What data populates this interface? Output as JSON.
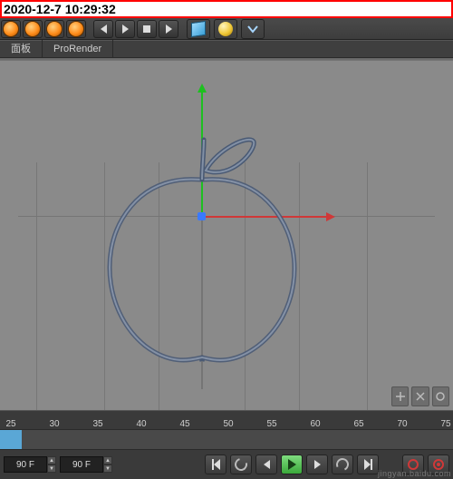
{
  "timestamp": "2020-12-7 10:29:32",
  "tabs": {
    "panel": "面板",
    "prorender": "ProRender"
  },
  "colors": {
    "axis_x": "#d03838",
    "axis_y": "#1ec020",
    "grid": "#777777",
    "viewport_bg": "#8a8a8a"
  },
  "timeline": {
    "ruler_marks": [
      "25",
      "30",
      "35",
      "40",
      "45",
      "50",
      "55",
      "60",
      "65",
      "70",
      "75"
    ],
    "frame_field_left": "90 F",
    "frame_field_right": "90 F"
  },
  "toolbar": {
    "icons": [
      "ring-orange-1",
      "ring-orange-2",
      "ring-orange-3",
      "ring-orange-4",
      "play-begin",
      "play-play",
      "play-square",
      "play-end",
      "cube-primitive",
      "sphere-primitive",
      "chevron-tool"
    ]
  },
  "watermark": "jingyan.baidu.com"
}
